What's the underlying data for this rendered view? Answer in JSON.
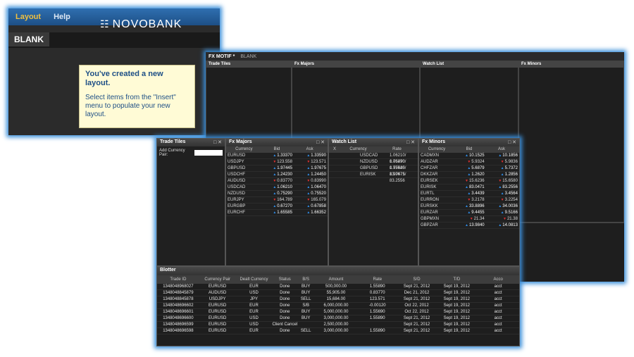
{
  "screen1": {
    "menu": [
      "Layout",
      "Help"
    ],
    "brand": "NOVOBANK",
    "tab": "BLANK",
    "tip_title": "You've created a new layout.",
    "tip_body": "Select items from the \"Insert\" menu to populate your new layout."
  },
  "screen2": {
    "tabs": [
      "FX MOTIF *",
      "BLANK"
    ],
    "panels": [
      "Trade Tiles",
      "Fx Majors",
      "Watch List",
      "Fx Minors"
    ]
  },
  "screen3": {
    "trade_tiles": {
      "title": "Trade Tiles",
      "add_label": "Add Currency Pair:"
    },
    "majors": {
      "title": "Fx Majors",
      "cols": [
        "Currency",
        "Bid",
        "Ask"
      ],
      "rows": [
        [
          "EURUSD",
          "1.33370",
          "1.33590"
        ],
        [
          "USDJPY",
          "123.558",
          "123.571"
        ],
        [
          "GBPUSD",
          "1.97445",
          "1.97675"
        ],
        [
          "USDCHF",
          "1.24230",
          "1.24450"
        ],
        [
          "AUDUSD",
          "0.83770",
          "0.83990"
        ],
        [
          "USDCAD",
          "1.06210",
          "1.06470"
        ],
        [
          "NZDUSD",
          "0.75290",
          "0.75520"
        ],
        [
          "EURJPY",
          "164.789",
          "165.079"
        ],
        [
          "EURGBP",
          "0.67270",
          "0.67858"
        ],
        [
          "EURCHF",
          "1.65585",
          "1.66352"
        ]
      ]
    },
    "watch": {
      "title": "Watch List",
      "cols": [
        "X",
        "Currency",
        "Rate"
      ],
      "rows": [
        [
          "",
          "USDCAD",
          "1.06210/ 1.06470"
        ],
        [
          "",
          "NZDUSD",
          "0.75290/ 0.75520"
        ],
        [
          "",
          "GBPUSD",
          "1.97445/ 1.97675"
        ],
        [
          "",
          "EURISK",
          "83.0471/ 83.2556"
        ]
      ]
    },
    "minors": {
      "title": "Fx Minors",
      "cols": [
        "Currency",
        "Bid",
        "Ask"
      ],
      "rows": [
        [
          "CADMXN",
          "10.1525",
          "10.1856"
        ],
        [
          "AUDZAR",
          "5.9324",
          "5.9836"
        ],
        [
          "CHFZAR",
          "5.6879",
          "5.7372"
        ],
        [
          "DKKZAR",
          "1.2620",
          "1.2856"
        ],
        [
          "EURSEK",
          "15.6236",
          "15.6580"
        ],
        [
          "EURISK",
          "83.0471",
          "83.2556"
        ],
        [
          "EURTL",
          "3.4439",
          "3.4564"
        ],
        [
          "EURRON",
          "3.2178",
          "3.2254"
        ],
        [
          "EURSKK",
          "33.8896",
          "34.0036"
        ],
        [
          "EURZAR",
          "9.4455",
          "9.5166"
        ],
        [
          "GBPMXN",
          "21.34",
          "21.38"
        ],
        [
          "GBPZAR",
          "13.9840",
          "14.0813"
        ]
      ]
    },
    "blotter": {
      "title": "Blotter",
      "cols": [
        "Trade ID",
        "Currency Pair",
        "Dealt Currency",
        "Status",
        "B/S",
        "Amount",
        "Rate",
        "S/D",
        "T/D",
        "Acco"
      ],
      "rows": [
        [
          "1348048968027",
          "EURUSD",
          "EUR",
          "Done",
          "BUY",
          "500,000.00",
          "1.55890",
          "Sept 21, 2012",
          "Sept 19, 2012",
          "acct"
        ],
        [
          "1348048845879",
          "AUDUSD",
          "USD",
          "Done",
          "BUY",
          "55,905.00",
          "0.83770",
          "Dec 21, 2012",
          "Sept 19, 2012",
          "acct"
        ],
        [
          "1348048845878",
          "USDJPY",
          "JPY",
          "Done",
          "SELL",
          "15,684.00",
          "123.571",
          "Sept 21, 2012",
          "Sept 19, 2012",
          "acct"
        ],
        [
          "1348048696602",
          "EURUSD",
          "EUR",
          "Done",
          "S/B",
          "6,000,000.00",
          "-0.00120",
          "Oct 22, 2012",
          "Sept 19, 2012",
          "acct"
        ],
        [
          "1348048696601",
          "EURUSD",
          "EUR",
          "Done",
          "BUY",
          "5,000,000.00",
          "1.55690",
          "Oct 22, 2012",
          "Sept 19, 2012",
          "acct"
        ],
        [
          "1348048696600",
          "EURUSD",
          "USD",
          "Done",
          "BUY",
          "3,000,000.00",
          "1.55890",
          "Sept 21, 2012",
          "Sept 19, 2012",
          "acct"
        ],
        [
          "1348048696599",
          "EURUSD",
          "USD",
          "Client Cancel",
          "",
          "2,500,000.00",
          "",
          "Sept 21, 2012",
          "Sept 19, 2012",
          "acct"
        ],
        [
          "1348048696598",
          "EURUSD",
          "EUR",
          "Done",
          "SELL",
          "3,000,000.00",
          "1.55890",
          "Sept 21, 2012",
          "Sept 19, 2012",
          "acct"
        ]
      ]
    }
  },
  "colors": {
    "accent": "#3b8fd9",
    "up": "#2e8be6",
    "down": "#e03030",
    "brand_blue": "#1d4f86"
  }
}
